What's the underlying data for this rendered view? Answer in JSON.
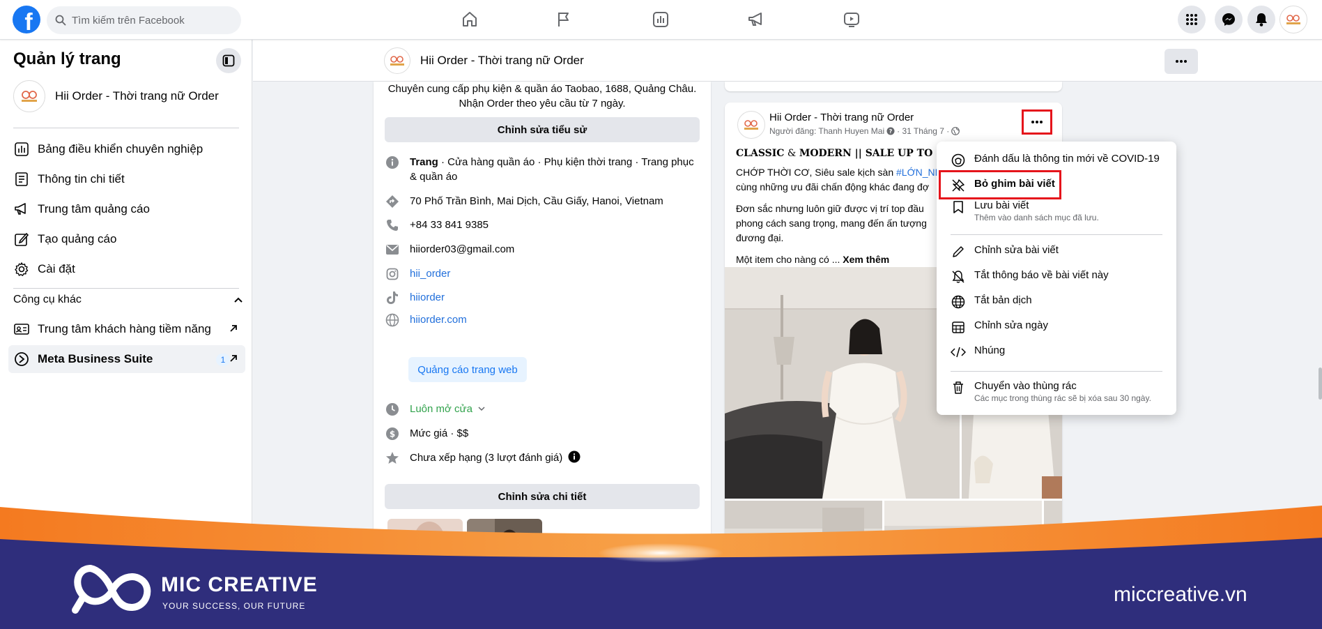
{
  "topbar": {
    "search_placeholder": "Tìm kiếm trên Facebook",
    "logo_letter": "f"
  },
  "sidebar": {
    "title": "Quản lý trang",
    "page_name": "Hii Order - Thời trang nữ Order",
    "items": [
      {
        "label": "Bảng điều khiển chuyên nghiệp",
        "icon": "dashboard-icon"
      },
      {
        "label": "Thông tin chi tiết",
        "icon": "insights-icon"
      },
      {
        "label": "Trung tâm quảng cáo",
        "icon": "megaphone-icon"
      },
      {
        "label": "Tạo quảng cáo",
        "icon": "edit-icon"
      },
      {
        "label": "Cài đặt",
        "icon": "gear-icon"
      }
    ],
    "section_title": "Công cụ khác",
    "tools": [
      {
        "label": "Trung tâm khách hàng tiềm năng",
        "icon": "contact-card-icon"
      },
      {
        "label": "Meta Business Suite",
        "icon": "meta-icon",
        "badge": "1"
      }
    ]
  },
  "pagebar": {
    "page_name": "Hii Order - Thời trang nữ Order"
  },
  "intro": {
    "bio": "Chuyên cung cấp phụ kiện & quần áo Taobao, 1688, Quảng Châu. Nhận Order theo yêu cầu từ 7 ngày.",
    "edit_bio_label": "Chỉnh sửa tiểu sử",
    "category_bold": "Trang",
    "category_rest": " · Cửa hàng quần áo · Phụ kiện thời trang · Trang phục & quần áo",
    "address": "70 Phố Trần Bình, Mai Dịch, Cầu Giấy, Hanoi, Vietnam",
    "phone": "+84 33 841 9385",
    "email": "hiiorder03@gmail.com",
    "instagram": "hii_order",
    "tiktok": "hiiorder",
    "website": "hiiorder.com",
    "promote_website_label": "Quảng cáo trang web",
    "hours": "Luôn mở cửa",
    "price": "Mức giá · $$",
    "rating": "Chưa xếp hạng (3 lượt đánh giá)",
    "edit_details_label": "Chỉnh sửa chi tiết"
  },
  "post": {
    "author": "Hii Order - Thời trang nữ Order",
    "meta_prefix": "Người đăng: Thanh Huyen Mai",
    "meta_date": "· 31 Tháng 7 ·",
    "headline_1": "CLASSIC",
    "headline_amp": " & ",
    "headline_2": "MODERN || SALE UP TO 50%",
    "line2_prefix": "CHỚP THỜI CƠ, Siêu sale kịch sàn ",
    "line2_tag": "#LỚN_NH",
    "line3": "cùng những ưu đãi chấn động khác đang đợ",
    "para2": "Đơn sắc nhưng luôn giữ được vị trí top đầu phong cách sang trọng, mang đến ấn tượng đương đại.",
    "para3_prefix": "Một item cho nàng có ...",
    "see_more": "Xem thêm"
  },
  "menu": {
    "items": [
      {
        "label": "Đánh dấu là thông tin mới về COVID-19",
        "sub": "",
        "icon": "covid-mark-icon"
      },
      {
        "label": "Bỏ ghim bài viết",
        "sub": "",
        "icon": "unpin-icon"
      },
      {
        "label": "Lưu bài viết",
        "sub": "Thêm vào danh sách mục đã lưu.",
        "icon": "bookmark-icon"
      },
      {
        "label": "Chỉnh sửa bài viết",
        "sub": "",
        "icon": "pencil-icon"
      },
      {
        "label": "Tắt thông báo về bài viết này",
        "sub": "",
        "icon": "bell-off-icon"
      },
      {
        "label": "Tắt bản dịch",
        "sub": "",
        "icon": "globe-icon"
      },
      {
        "label": "Chỉnh sửa ngày",
        "sub": "",
        "icon": "calendar-icon"
      },
      {
        "label": "Nhúng",
        "sub": "",
        "icon": "code-icon"
      },
      {
        "label": "Chuyển vào thùng rác",
        "sub": "Các mục trong thùng rác sẽ bị xóa sau 30 ngày.",
        "icon": "trash-icon"
      }
    ]
  },
  "banner": {
    "brand": "MIC CREATIVE",
    "tagline": "YOUR SUCCESS, OUR FUTURE",
    "url": "miccreative.vn"
  },
  "colors": {
    "facebook_blue": "#1877f2",
    "highlight_red": "#e5141b",
    "banner_navy": "#2f2e7c",
    "banner_orange": "#f47a20"
  }
}
